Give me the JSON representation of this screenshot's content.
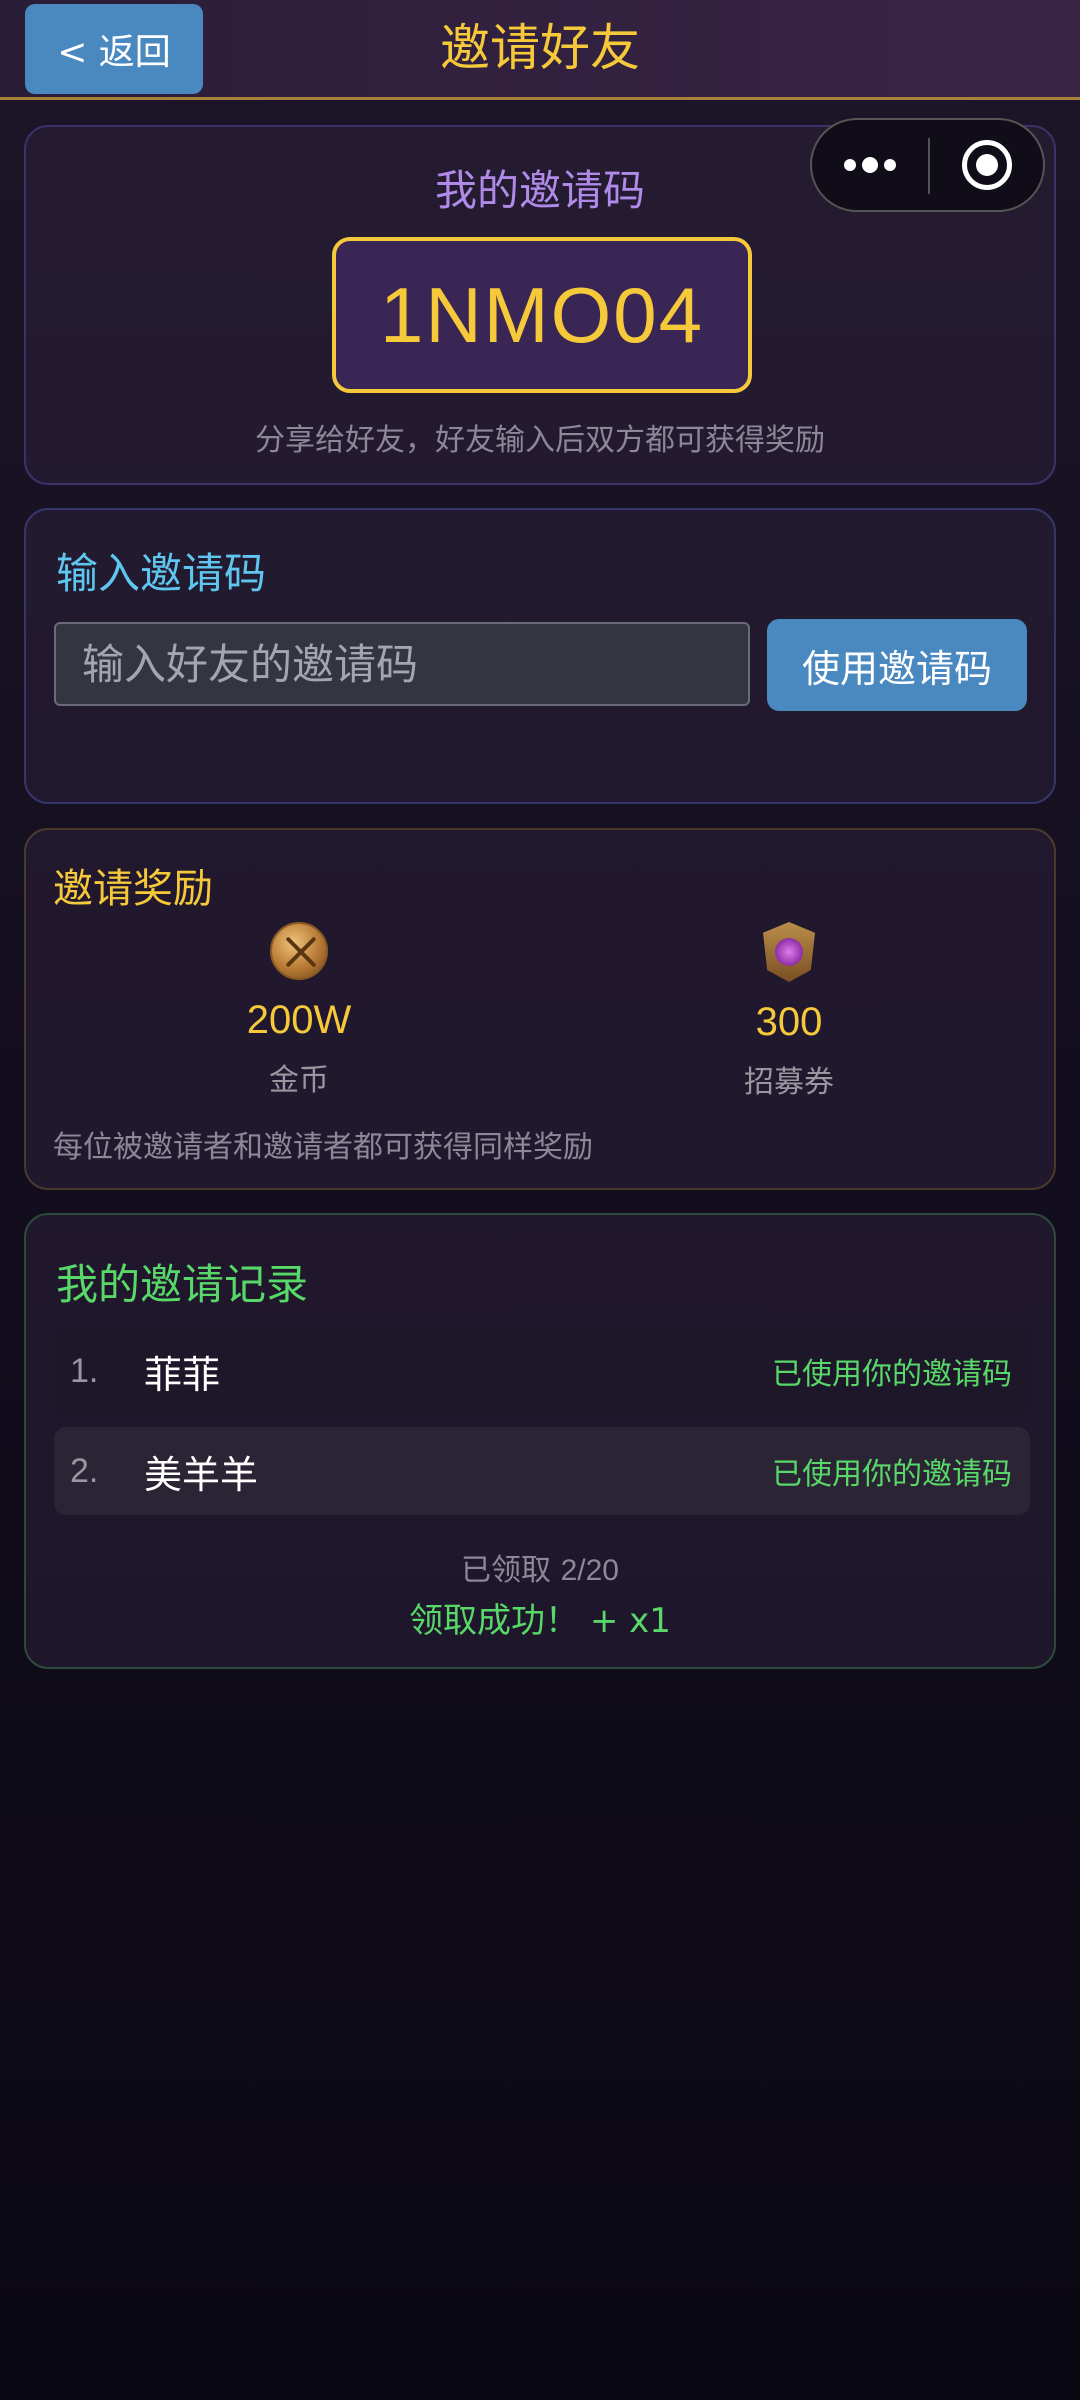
{
  "header": {
    "back_label": "< 返回",
    "title": "邀请好友"
  },
  "my_code": {
    "title": "我的邀请码",
    "code": "1NMO04",
    "hint": "分享给好友，好友输入后双方都可获得奖励"
  },
  "enter_code": {
    "title": "输入邀请码",
    "placeholder": "输入好友的邀请码",
    "value": "",
    "button_label": "使用邀请码"
  },
  "rewards": {
    "title": "邀请奖励",
    "items": [
      {
        "icon": "gold-coin-icon",
        "amount": "200W",
        "name": "金币"
      },
      {
        "icon": "recruit-ticket-icon",
        "amount": "300",
        "name": "招募券"
      }
    ],
    "note": "每位被邀请者和邀请者都可获得同样奖励"
  },
  "records": {
    "title": "我的邀请记录",
    "items": [
      {
        "index": "1.",
        "name": "菲菲",
        "status": "已使用你的邀请码"
      },
      {
        "index": "2.",
        "name": "美羊羊",
        "status": "已使用你的邀请码"
      }
    ],
    "claimed_label": "已领取",
    "claimed_value": "2/20",
    "success_message": "领取成功！ + x1"
  },
  "colors": {
    "accent_gold": "#f5c93a",
    "accent_blue": "#4a88c0",
    "accent_green": "#58d868",
    "accent_purple": "#b08ae8",
    "accent_cyan": "#5fc6f0"
  }
}
